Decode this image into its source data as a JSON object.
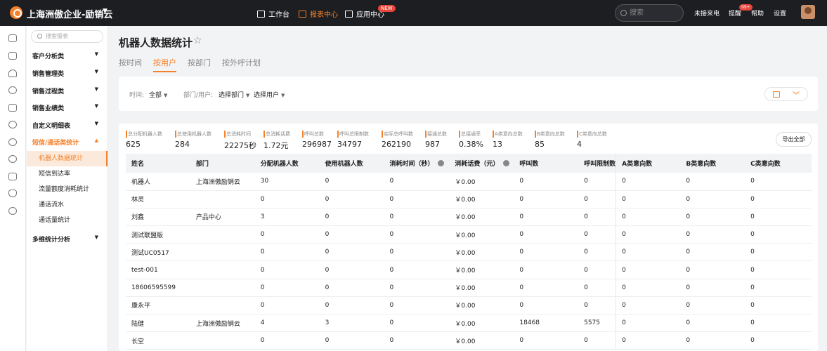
{
  "header": {
    "brand": "上海洲傲企业-励销云",
    "nav": [
      {
        "label": "工作台"
      },
      {
        "label": "报表中心",
        "active": true
      },
      {
        "label": "应用中心"
      }
    ],
    "new_badge": "NEW",
    "search_placeholder": "搜索",
    "missed_calls": "未接来电",
    "reminder": "提醒",
    "reminder_badge": "99+",
    "help": "帮助",
    "settings": "设置"
  },
  "sidebar": {
    "search_placeholder": "搜索报表",
    "categories": [
      "客户分析类",
      "销售管理类",
      "销售过程类",
      "销售业绩类",
      "自定义明细表",
      "短信/通话类统计",
      "多维统计分析"
    ],
    "sub_items": [
      "机器人数据统计",
      "短信到达率",
      "流量额度消耗统计",
      "通话流水",
      "通话量统计"
    ]
  },
  "page": {
    "title": "机器人数据统计",
    "tabs": [
      "按时间",
      "按用户",
      "按部门",
      "按外呼计划"
    ],
    "active_tab": 1
  },
  "filters": {
    "time_label": "时间:",
    "time_value": "全部",
    "dept_label": "部门/用户:",
    "dept_value": "选择部门",
    "user_value": "选择用户"
  },
  "stats": [
    {
      "label": "总分配机器人数",
      "value": "625"
    },
    {
      "label": "总使用机器人数",
      "value": "284"
    },
    {
      "label": "总消耗时间",
      "value": "22275秒"
    },
    {
      "label": "总消耗话费",
      "value": "1.72元"
    },
    {
      "label": "呼叫总数",
      "value": "296987"
    },
    {
      "label": "呼叫总限制数",
      "value": "34797"
    },
    {
      "label": "实际总呼叫数",
      "value": "262190"
    },
    {
      "label": "接通总数",
      "value": "987"
    },
    {
      "label": "总接通率",
      "value": "0.38%"
    },
    {
      "label": "A类意向总数",
      "value": "13"
    },
    {
      "label": "B类意向总数",
      "value": "85"
    },
    {
      "label": "C类意向总数",
      "value": "4"
    }
  ],
  "export_label": "导出全部",
  "table": {
    "columns": [
      "姓名",
      "部门",
      "分配机器人数",
      "使用机器人数",
      "消耗时间（秒）",
      "消耗话费（元）",
      "呼叫数",
      "呼叫限制数",
      "A类意向数",
      "B类意向数",
      "C类意向数"
    ],
    "rows": [
      [
        "机器人",
        "上海洲傲励销云",
        "30",
        "0",
        "0",
        "￥0.00",
        "0",
        "0",
        "0",
        "0",
        "0"
      ],
      [
        "林灵",
        "",
        "0",
        "0",
        "0",
        "￥0.00",
        "0",
        "0",
        "0",
        "0",
        "0"
      ],
      [
        "刘鑫",
        "产品中心",
        "3",
        "0",
        "0",
        "￥0.00",
        "0",
        "0",
        "0",
        "0",
        "0"
      ],
      [
        "测试联盟版",
        "",
        "0",
        "0",
        "0",
        "￥0.00",
        "0",
        "0",
        "0",
        "0",
        "0"
      ],
      [
        "测试UC0517",
        "",
        "0",
        "0",
        "0",
        "￥0.00",
        "0",
        "0",
        "0",
        "0",
        "0"
      ],
      [
        "test-001",
        "",
        "0",
        "0",
        "0",
        "￥0.00",
        "0",
        "0",
        "0",
        "0",
        "0"
      ],
      [
        "18606595599",
        "",
        "0",
        "0",
        "0",
        "￥0.00",
        "0",
        "0",
        "0",
        "0",
        "0"
      ],
      [
        "康永平",
        "",
        "0",
        "0",
        "0",
        "￥0.00",
        "0",
        "0",
        "0",
        "0",
        "0"
      ],
      [
        "陆健",
        "上海洲傲励销云",
        "4",
        "3",
        "0",
        "￥0.00",
        "18468",
        "5575",
        "0",
        "0",
        "0"
      ],
      [
        "长空",
        "",
        "0",
        "0",
        "0",
        "￥0.00",
        "0",
        "0",
        "0",
        "0",
        "0"
      ]
    ]
  },
  "colors": {
    "accent": "#f5812b",
    "topbar": "#1c1e22"
  }
}
